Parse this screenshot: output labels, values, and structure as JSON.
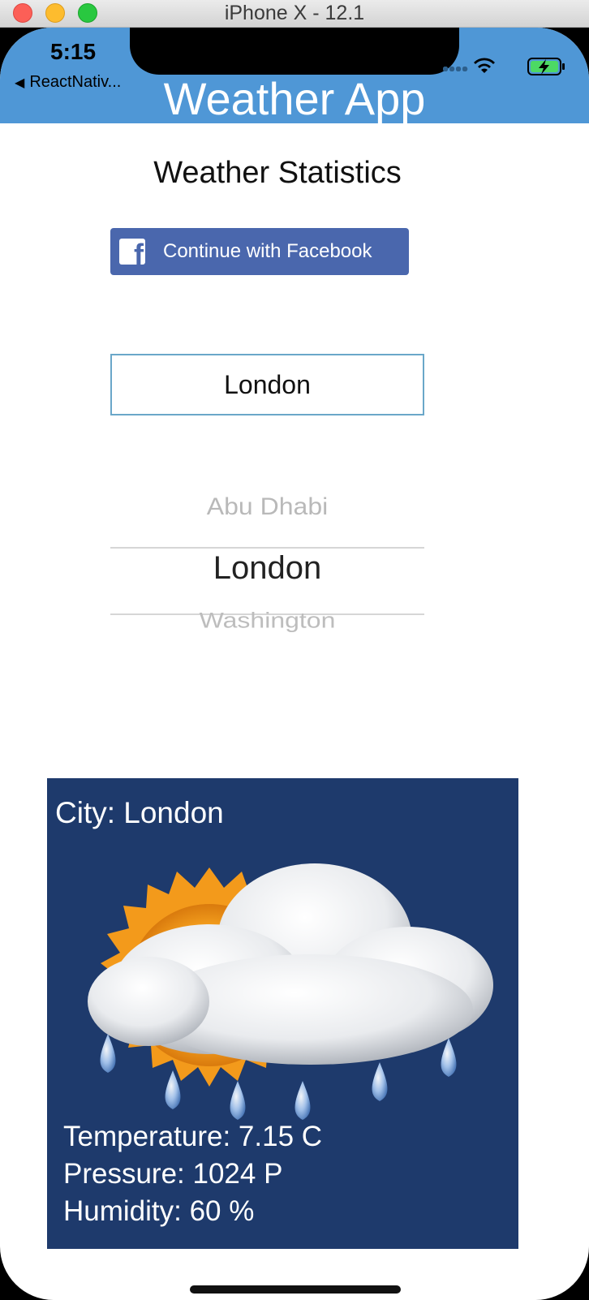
{
  "window": {
    "title": "iPhone X - 12.1"
  },
  "status_bar": {
    "time": "5:15",
    "back_label": "ReactNativ...",
    "back_icon": "back-triangle-icon"
  },
  "header": {
    "title": "Weather App"
  },
  "page": {
    "heading": "Weather Statistics"
  },
  "facebook": {
    "label": "Continue with Facebook",
    "icon": "facebook-icon"
  },
  "city_input": {
    "value": "London"
  },
  "picker": {
    "items": [
      "Abu Dhabi",
      "London",
      "Washington"
    ],
    "selected": "London"
  },
  "weather": {
    "city": "City: London",
    "temperature": "Temperature: 7.15 C",
    "pressure": "Pressure: 1024 P",
    "humidity": "Humidity: 60 %",
    "icon": "partly-cloudy-rain-icon"
  },
  "colors": {
    "header": "#4f97d6",
    "facebook": "#4a67ad",
    "card": "#1e3a6c"
  }
}
